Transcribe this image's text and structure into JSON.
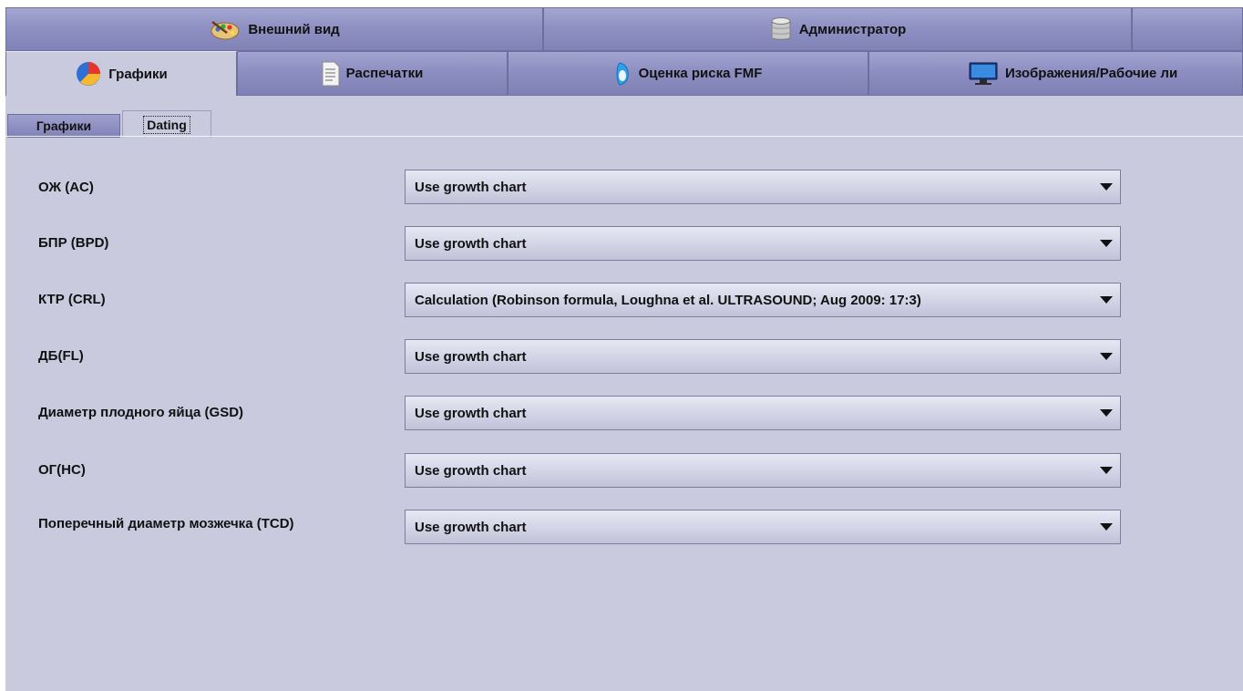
{
  "top_tabs": [
    {
      "label": "Внешний вид",
      "icon": "palette-icon"
    },
    {
      "label": "Администратор",
      "icon": "database-icon"
    },
    {
      "label": "",
      "icon": ""
    }
  ],
  "main_tabs": [
    {
      "label": "Графики",
      "icon": "chart-icon",
      "active": true
    },
    {
      "label": "Распечатки",
      "icon": "document-icon",
      "active": false
    },
    {
      "label": "Оценка риска FMF",
      "icon": "fmf-icon",
      "active": false
    },
    {
      "label": "Изображения/Рабочие ли",
      "icon": "monitor-icon",
      "active": false
    }
  ],
  "sub_tabs": [
    {
      "label": "Графики",
      "active": false
    },
    {
      "label": "Dating",
      "active": true
    }
  ],
  "settings": [
    {
      "label": "ОЖ (AC)",
      "value": "Use growth chart"
    },
    {
      "label": "БПР (BPD)",
      "value": "Use growth chart"
    },
    {
      "label": "КТР (CRL)",
      "value": "Calculation (Robinson formula, Loughna et al. ULTRASOUND; Aug 2009: 17:3)"
    },
    {
      "label": "ДБ(FL)",
      "value": "Use growth chart"
    },
    {
      "label": "Диаметр плодного яйца (GSD)",
      "value": "Use growth chart"
    },
    {
      "label": "ОГ(HC)",
      "value": "Use growth chart"
    },
    {
      "label": "Поперечный диаметр мозжечка (TCD)",
      "value": "Use growth chart"
    }
  ],
  "colors": {
    "background": "#c9cade",
    "tab": "#8f91c3",
    "dropdown": "#d2d3e5"
  }
}
